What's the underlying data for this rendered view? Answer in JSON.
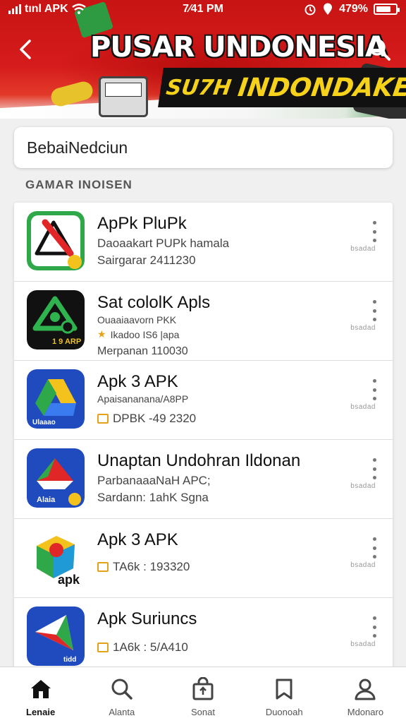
{
  "status_bar": {
    "carrier": "tınl APK",
    "time": "7⁄41 PM",
    "battery": "479%",
    "battery_level": 0.75
  },
  "header": {
    "banner_title": "PUSAR UNDONESIA",
    "banner_subtitle_left": "SU7H",
    "banner_subtitle_right": "INDONDAKE",
    "back_icon": "chevron-left-icon",
    "search_icon": "search-icon"
  },
  "search": {
    "value": "BebaiNedciun"
  },
  "section": {
    "label": "GAMAR INOISEN"
  },
  "apps": [
    {
      "name": "ApPk PluPk",
      "line1": "Daoaakart PUPk hamala",
      "line2": "Sairgarar 2411230",
      "meta": "bsadad",
      "icon": "warning-triangle-icon",
      "icon_bg": "#2fa84a"
    },
    {
      "name": "Sat cololK Apls",
      "line1": "Ouaaiaavorn PKK",
      "line2": "Ikadoo IS6 |apa",
      "line3": "Merpanan 110030",
      "meta": "bsadad",
      "icon": "leaf-triangle-icon",
      "icon_badge": "1 9 ARP",
      "icon_bg": "#111111"
    },
    {
      "name": "Apk 3 APK",
      "line1": "Apaisananana/A8PP",
      "line2": "DPBK -49 2320",
      "meta": "bsadad",
      "icon": "drive-triangle-icon",
      "icon_badge": "Ulaaao",
      "icon_bg": "#1f4bbf"
    },
    {
      "name": "Unaptan Undohran Ildonan",
      "line1": "ParbanaaaNaH APC;",
      "line2": "Sardann: 1ahK Sgna",
      "meta": "bsadad",
      "icon": "play-triangle-icon",
      "icon_badge": "Alaia",
      "icon_bg": "#1f4bbf"
    },
    {
      "name": "Apk 3 APK",
      "line1": "",
      "line2": "TA6k : 193320",
      "meta": "bsadad",
      "icon": "cube-icon",
      "icon_badge": "apk",
      "icon_bg": "#ffffff"
    },
    {
      "name": "Apk Suriuncs",
      "line1": "",
      "line2": "1A6k : 5/A410",
      "meta": "bsadad",
      "icon": "paper-plane-icon",
      "icon_badge": "tidd",
      "icon_bg": "#1f4bbf"
    }
  ],
  "bottom_nav": [
    {
      "label": "Lenaie",
      "icon": "home-icon",
      "active": true
    },
    {
      "label": "Alanta",
      "icon": "search-icon",
      "active": false
    },
    {
      "label": "Sonat",
      "icon": "bag-icon",
      "active": false
    },
    {
      "label": "Duonoah",
      "icon": "bookmark-icon",
      "active": false
    },
    {
      "label": "Mdonaro",
      "icon": "profile-icon",
      "active": false
    }
  ],
  "colors": {
    "header_red": "#d61b1b",
    "banner_yellow": "#f6d21a",
    "accent_orange": "#e3a21a"
  }
}
